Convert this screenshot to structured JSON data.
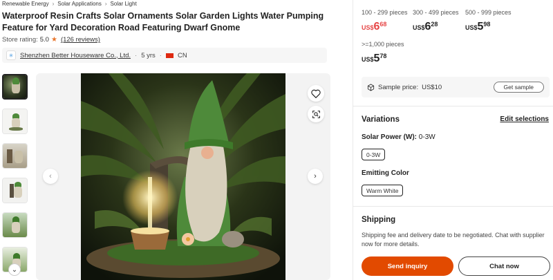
{
  "breadcrumb": [
    "Renewable Energy",
    "Solar Applications",
    "Solar Light"
  ],
  "title": "Waterproof Resin Crafts Solar Ornaments Solar Garden Lights Water Pumping Feature for Yard Decoration Road Featuring Dwarf Gnome",
  "rating": {
    "label": "Store rating:",
    "value": "5.0",
    "reviews": "(126 reviews)"
  },
  "supplier": {
    "name": "Shenzhen Better Houseware Co., Ltd.",
    "years": "5 yrs",
    "country": "CN"
  },
  "price_tiers": [
    {
      "range": "100 - 299 pieces",
      "currency": "US$",
      "whole": "6",
      "decimal": "68",
      "highlight": true
    },
    {
      "range": "300 - 499 pieces",
      "currency": "US$",
      "whole": "6",
      "decimal": "28",
      "highlight": false
    },
    {
      "range": "500 - 999 pieces",
      "currency": "US$",
      "whole": "5",
      "decimal": "98",
      "highlight": false
    },
    {
      "range": ">=1,000 pieces",
      "currency": "US$",
      "whole": "5",
      "decimal": "78",
      "highlight": false
    }
  ],
  "sample": {
    "label": "Sample price:",
    "value": "US$10",
    "button": "Get sample"
  },
  "variations": {
    "title": "Variations",
    "edit": "Edit selections",
    "attributes": [
      {
        "name": "Solar Power (W):",
        "value": "0-3W",
        "chip": "0-3W"
      },
      {
        "name": "Emitting Color",
        "value": "",
        "chip": "Warm White"
      }
    ]
  },
  "shipping": {
    "title": "Shipping",
    "text": "Shipping fee and delivery date to be negotiated. Chat with supplier now for more details."
  },
  "actions": {
    "inquiry": "Send inquiry",
    "chat": "Chat now"
  },
  "colors": {
    "accent": "#e24a00",
    "price_red": "#e64545"
  },
  "icons": [
    "chevron-right-icon",
    "star-icon",
    "heart-icon",
    "image-search-icon",
    "chevron-left-icon",
    "chevron-down-icon",
    "cube-icon"
  ]
}
